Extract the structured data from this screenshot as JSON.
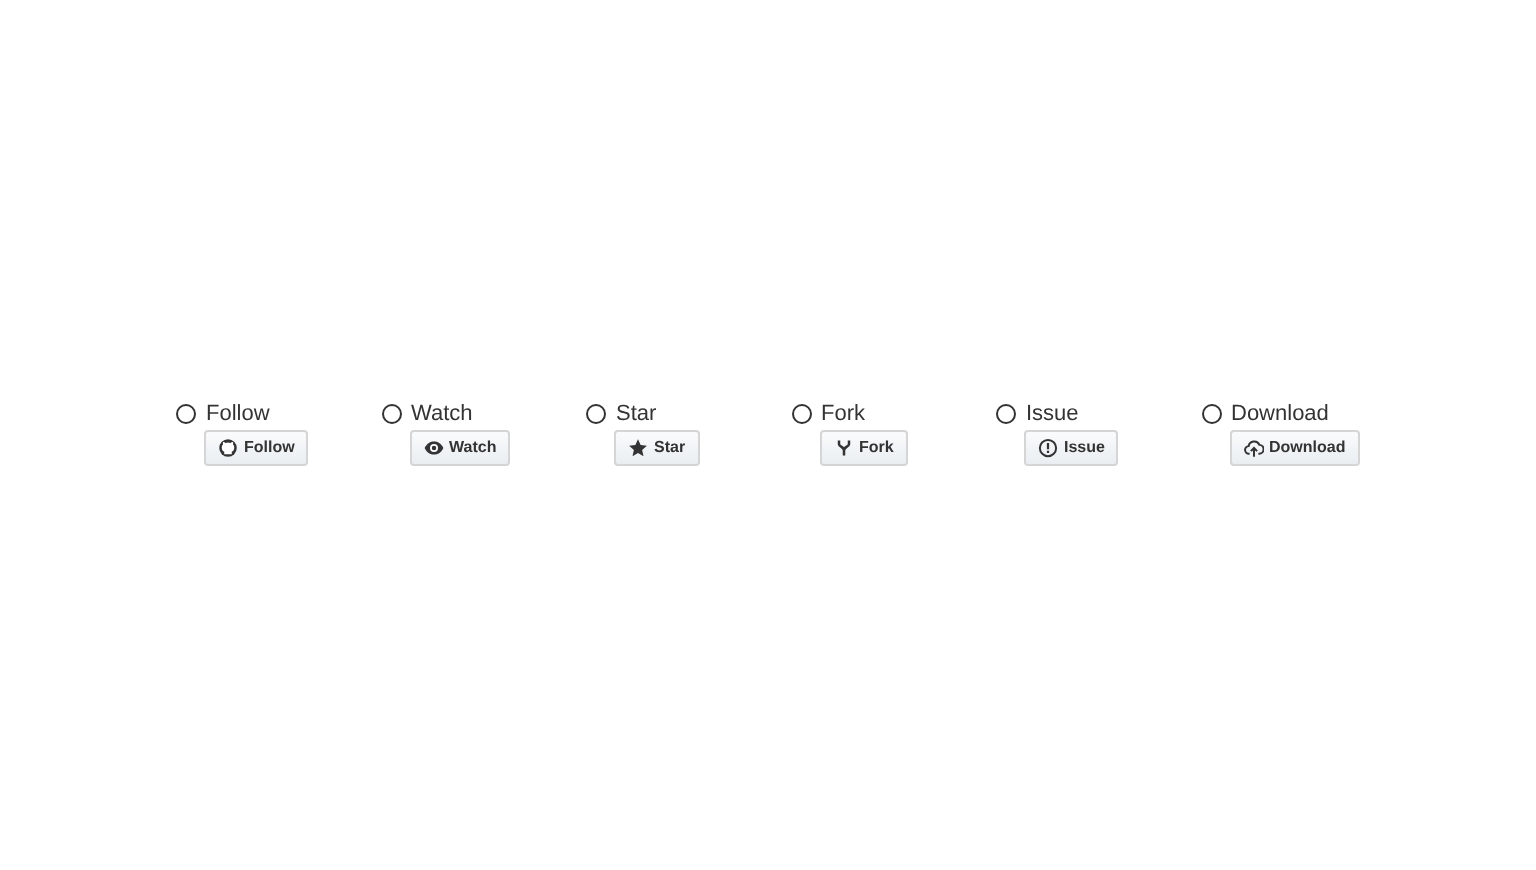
{
  "options": [
    {
      "kind": "follow",
      "label": "Follow",
      "selected": false,
      "button": "Follow"
    },
    {
      "kind": "watch",
      "label": "Watch",
      "selected": false,
      "button": "Watch"
    },
    {
      "kind": "star",
      "label": "Star",
      "selected": false,
      "button": "Star"
    },
    {
      "kind": "fork",
      "label": "Fork",
      "selected": false,
      "button": "Fork"
    },
    {
      "kind": "issue",
      "label": "Issue",
      "selected": false,
      "button": "Issue"
    },
    {
      "kind": "download",
      "label": "Download",
      "selected": false,
      "button": "Download"
    }
  ]
}
